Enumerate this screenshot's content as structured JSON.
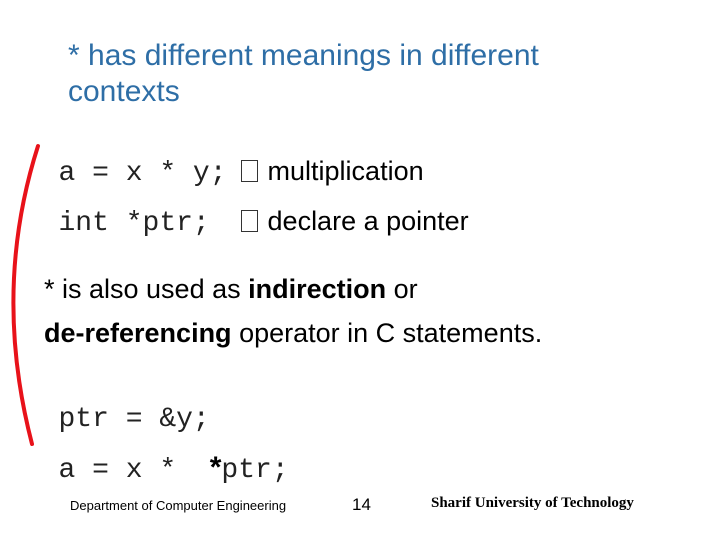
{
  "slide": {
    "title": "* has different meanings in different contexts",
    "title_color": "#2E6EA6",
    "lines": [
      {
        "code": "a = x * y;",
        "arrow_icon": "right-arrow-icon",
        "desc": "multiplication"
      },
      {
        "code": "int *ptr; ",
        "arrow_icon": "right-arrow-icon",
        "desc": "declare a pointer"
      }
    ],
    "explanation": {
      "part1": "* is also used as ",
      "bold1": "indirection",
      "part2": " or",
      "bold2": "de-referencing",
      "part3": " operator in C statements."
    },
    "code_lines": {
      "line1": "ptr = &y;",
      "line2_prefix": "a = x *  ",
      "line2_bold": "*",
      "line2_suffix": "ptr;"
    },
    "bracket_color": "#E8121A"
  },
  "footer": {
    "department": "Department of Computer Engineering",
    "page_number": "14",
    "university": "Sharif University of Technology"
  }
}
